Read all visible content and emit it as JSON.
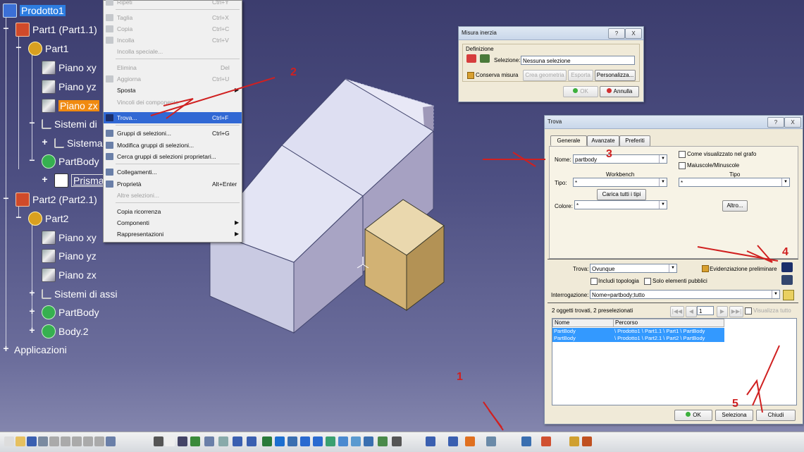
{
  "tree": {
    "root": "Prodotto1",
    "part1_instance": "Part1 (Part1.1)",
    "part1": "Part1",
    "p1_plane_xy": "Piano xy",
    "p1_plane_yz": "Piano yz",
    "p1_plane_zx": "Piano zx",
    "p1_axes": "Sistemi di",
    "p1_axis_system": "Sistema",
    "p1_partbody": "PartBody",
    "p1_prism": "Prisma",
    "part2_instance": "Part2 (Part2.1)",
    "part2": "Part2",
    "p2_plane_xy": "Piano xy",
    "p2_plane_yz": "Piano yz",
    "p2_plane_zx": "Piano zx",
    "p2_axes": "Sistemi di assi",
    "p2_partbody": "PartBody",
    "p2_body2": "Body.2",
    "applications": "Applicazioni"
  },
  "context_menu": {
    "items": [
      {
        "label": "Ripeti",
        "shortcut": "Ctrl+Y",
        "enabled": false
      },
      {
        "label": "Taglia",
        "shortcut": "Ctrl+X",
        "enabled": false
      },
      {
        "label": "Copia",
        "shortcut": "Ctrl+C",
        "enabled": false
      },
      {
        "label": "Incolla",
        "shortcut": "Ctrl+V",
        "enabled": false
      },
      {
        "label": "Incolla speciale...",
        "shortcut": "",
        "enabled": false
      },
      {
        "label": "Elimina",
        "shortcut": "Del",
        "enabled": false
      },
      {
        "label": "Aggiorna",
        "shortcut": "Ctrl+U",
        "enabled": false
      },
      {
        "label": "Sposta",
        "shortcut": "",
        "enabled": true
      },
      {
        "label": "Vincoli dei componente",
        "shortcut": "",
        "enabled": false
      },
      {
        "label": "Trova...",
        "shortcut": "Ctrl+F",
        "enabled": true
      },
      {
        "label": "Gruppi di selezioni...",
        "shortcut": "Ctrl+G",
        "enabled": true
      },
      {
        "label": "Modifica gruppi di selezioni...",
        "shortcut": "",
        "enabled": true
      },
      {
        "label": "Cerca gruppi di selezioni proprietari...",
        "shortcut": "",
        "enabled": true
      },
      {
        "label": "Collegamenti...",
        "shortcut": "",
        "enabled": true
      },
      {
        "label": "Proprietà",
        "shortcut": "Alt+Enter",
        "enabled": true
      },
      {
        "label": "Altre selezioni...",
        "shortcut": "",
        "enabled": false
      },
      {
        "label": "Copia ricorrenza",
        "shortcut": "",
        "enabled": true
      },
      {
        "label": "Componenti",
        "shortcut": "",
        "enabled": true
      },
      {
        "label": "Rappresentazioni",
        "shortcut": "",
        "enabled": true
      }
    ]
  },
  "inertia_dialog": {
    "title": "Misura inerzia",
    "help": "?",
    "close": "X",
    "group": "Definizione",
    "selection_label": "Selezione:",
    "selection_value": "Nessuna selezione",
    "keep_measure": "Conserva misura",
    "create_geometry": "Crea geometria",
    "export": "Esporta",
    "customize": "Personalizza...",
    "ok": "OK",
    "cancel": "Annulla"
  },
  "find_dialog": {
    "title": "Trova",
    "help": "?",
    "close": "X",
    "tabs": [
      "Generale",
      "Avanzate",
      "Preferiti"
    ],
    "name_label": "Nome:",
    "name_value": "partbody",
    "as_shown_in_graph": "Come visualizzato nel grafo",
    "case_sensitive": "Maiuscole/Minuscole",
    "workbench_label": "Workbench",
    "type_col_label": "Tipo",
    "type_label": "Tipo:",
    "type_workbench_value": "*",
    "type_value": "*",
    "load_all_types": "Carica tutti i tipi",
    "color_label": "Colore:",
    "color_value": "*",
    "more": "Altro...",
    "find_label": "Trova:",
    "find_value": "Ovunque",
    "preliminary_highlight": "Evidenziazione preliminare",
    "include_topology": "Includi topologia",
    "public_only": "Solo elementi pubblici",
    "query_label": "Interrogazione:",
    "query_value": "Nome=partbody;tutto",
    "found_text": "2 oggetti trovati, 2 preselezionati",
    "page_value": "1",
    "show_all": "Visualizza tutto",
    "col_name": "Nome",
    "col_path": "Percorso",
    "results": [
      {
        "name": "PartBody",
        "path": "\\ Prodotto1 \\ Part1.1 \\ Part1 \\ PartBody"
      },
      {
        "name": "PartBody",
        "path": "\\ Prodotto1 \\ Part2.1 \\ Part2 \\ PartBody"
      }
    ],
    "ok": "OK",
    "select": "Seleziona",
    "close_btn": "Chiudi"
  },
  "annotations": {
    "n1": "1",
    "n2": "2",
    "n3": "3",
    "n4": "4",
    "n5": "5",
    "color": "#d02020"
  },
  "colors": {
    "selection": "#2d7de0",
    "highlight": "#f08a10",
    "menu_hot": "#3168d4",
    "dialog_bg": "#f0ead8"
  }
}
